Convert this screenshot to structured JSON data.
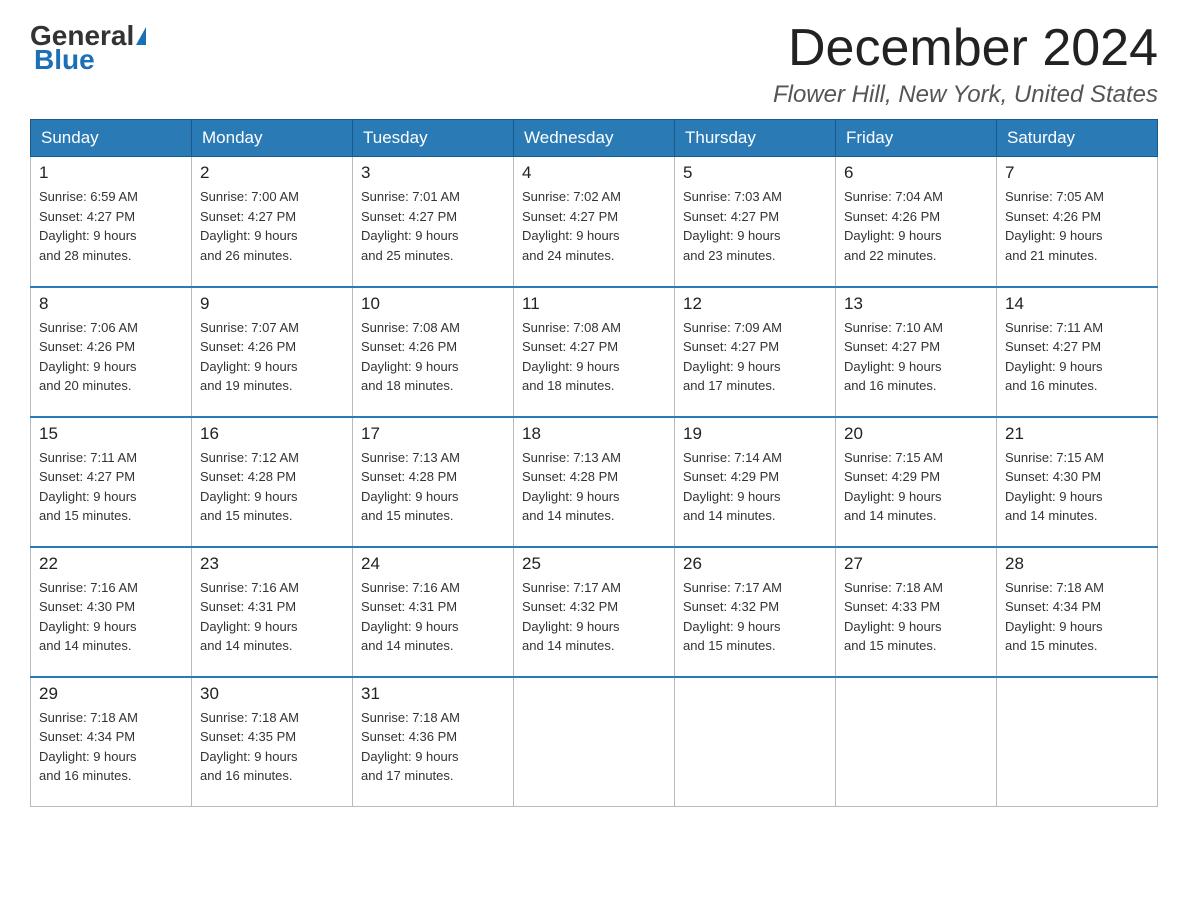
{
  "header": {
    "logo": {
      "general": "General",
      "blue": "Blue"
    },
    "title": "December 2024",
    "location": "Flower Hill, New York, United States"
  },
  "calendar": {
    "days_of_week": [
      "Sunday",
      "Monday",
      "Tuesday",
      "Wednesday",
      "Thursday",
      "Friday",
      "Saturday"
    ],
    "weeks": [
      [
        {
          "day": "1",
          "sunrise": "6:59 AM",
          "sunset": "4:27 PM",
          "daylight": "9 hours and 28 minutes."
        },
        {
          "day": "2",
          "sunrise": "7:00 AM",
          "sunset": "4:27 PM",
          "daylight": "9 hours and 26 minutes."
        },
        {
          "day": "3",
          "sunrise": "7:01 AM",
          "sunset": "4:27 PM",
          "daylight": "9 hours and 25 minutes."
        },
        {
          "day": "4",
          "sunrise": "7:02 AM",
          "sunset": "4:27 PM",
          "daylight": "9 hours and 24 minutes."
        },
        {
          "day": "5",
          "sunrise": "7:03 AM",
          "sunset": "4:27 PM",
          "daylight": "9 hours and 23 minutes."
        },
        {
          "day": "6",
          "sunrise": "7:04 AM",
          "sunset": "4:26 PM",
          "daylight": "9 hours and 22 minutes."
        },
        {
          "day": "7",
          "sunrise": "7:05 AM",
          "sunset": "4:26 PM",
          "daylight": "9 hours and 21 minutes."
        }
      ],
      [
        {
          "day": "8",
          "sunrise": "7:06 AM",
          "sunset": "4:26 PM",
          "daylight": "9 hours and 20 minutes."
        },
        {
          "day": "9",
          "sunrise": "7:07 AM",
          "sunset": "4:26 PM",
          "daylight": "9 hours and 19 minutes."
        },
        {
          "day": "10",
          "sunrise": "7:08 AM",
          "sunset": "4:26 PM",
          "daylight": "9 hours and 18 minutes."
        },
        {
          "day": "11",
          "sunrise": "7:08 AM",
          "sunset": "4:27 PM",
          "daylight": "9 hours and 18 minutes."
        },
        {
          "day": "12",
          "sunrise": "7:09 AM",
          "sunset": "4:27 PM",
          "daylight": "9 hours and 17 minutes."
        },
        {
          "day": "13",
          "sunrise": "7:10 AM",
          "sunset": "4:27 PM",
          "daylight": "9 hours and 16 minutes."
        },
        {
          "day": "14",
          "sunrise": "7:11 AM",
          "sunset": "4:27 PM",
          "daylight": "9 hours and 16 minutes."
        }
      ],
      [
        {
          "day": "15",
          "sunrise": "7:11 AM",
          "sunset": "4:27 PM",
          "daylight": "9 hours and 15 minutes."
        },
        {
          "day": "16",
          "sunrise": "7:12 AM",
          "sunset": "4:28 PM",
          "daylight": "9 hours and 15 minutes."
        },
        {
          "day": "17",
          "sunrise": "7:13 AM",
          "sunset": "4:28 PM",
          "daylight": "9 hours and 15 minutes."
        },
        {
          "day": "18",
          "sunrise": "7:13 AM",
          "sunset": "4:28 PM",
          "daylight": "9 hours and 14 minutes."
        },
        {
          "day": "19",
          "sunrise": "7:14 AM",
          "sunset": "4:29 PM",
          "daylight": "9 hours and 14 minutes."
        },
        {
          "day": "20",
          "sunrise": "7:15 AM",
          "sunset": "4:29 PM",
          "daylight": "9 hours and 14 minutes."
        },
        {
          "day": "21",
          "sunrise": "7:15 AM",
          "sunset": "4:30 PM",
          "daylight": "9 hours and 14 minutes."
        }
      ],
      [
        {
          "day": "22",
          "sunrise": "7:16 AM",
          "sunset": "4:30 PM",
          "daylight": "9 hours and 14 minutes."
        },
        {
          "day": "23",
          "sunrise": "7:16 AM",
          "sunset": "4:31 PM",
          "daylight": "9 hours and 14 minutes."
        },
        {
          "day": "24",
          "sunrise": "7:16 AM",
          "sunset": "4:31 PM",
          "daylight": "9 hours and 14 minutes."
        },
        {
          "day": "25",
          "sunrise": "7:17 AM",
          "sunset": "4:32 PM",
          "daylight": "9 hours and 14 minutes."
        },
        {
          "day": "26",
          "sunrise": "7:17 AM",
          "sunset": "4:32 PM",
          "daylight": "9 hours and 15 minutes."
        },
        {
          "day": "27",
          "sunrise": "7:18 AM",
          "sunset": "4:33 PM",
          "daylight": "9 hours and 15 minutes."
        },
        {
          "day": "28",
          "sunrise": "7:18 AM",
          "sunset": "4:34 PM",
          "daylight": "9 hours and 15 minutes."
        }
      ],
      [
        {
          "day": "29",
          "sunrise": "7:18 AM",
          "sunset": "4:34 PM",
          "daylight": "9 hours and 16 minutes."
        },
        {
          "day": "30",
          "sunrise": "7:18 AM",
          "sunset": "4:35 PM",
          "daylight": "9 hours and 16 minutes."
        },
        {
          "day": "31",
          "sunrise": "7:18 AM",
          "sunset": "4:36 PM",
          "daylight": "9 hours and 17 minutes."
        },
        null,
        null,
        null,
        null
      ]
    ],
    "labels": {
      "sunrise": "Sunrise:",
      "sunset": "Sunset:",
      "daylight": "Daylight:"
    }
  }
}
